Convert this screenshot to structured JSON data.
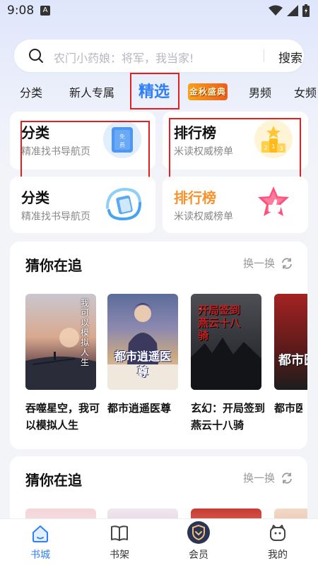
{
  "status_bar": {
    "time": "9:08",
    "notification_badge": "A"
  },
  "search": {
    "placeholder": "农门小药娘：将军，我当家!",
    "button_label": "搜索"
  },
  "tabs": [
    {
      "label": "分类"
    },
    {
      "label": "新人专属"
    },
    {
      "label": "精选",
      "active": true
    },
    {
      "label": "金秋盛典",
      "type": "event-badge"
    },
    {
      "label": "男频"
    },
    {
      "label": "女频"
    }
  ],
  "quick_cards": [
    {
      "title": "分类",
      "subtitle": "精准找书导航页",
      "icon": "book-free-icon",
      "icon_text": "免费"
    },
    {
      "title": "排行榜",
      "subtitle": "米读权威榜单",
      "icon": "podium-icon",
      "icon_text": "2 1 3"
    },
    {
      "title": "分类",
      "subtitle": "精准找书导航页",
      "icon": "swirl-book-icon"
    },
    {
      "title": "排行榜",
      "subtitle": "米读权威榜单",
      "icon": "thumbs-up-star-icon",
      "title_color": "#f7932c"
    }
  ],
  "sections": [
    {
      "title": "猜你在追",
      "refresh_label": "换一换",
      "books": [
        {
          "title": "吞噬星空，我可以模拟人生",
          "cover_text": "我可以模拟人生"
        },
        {
          "title": "都市逍遥医尊",
          "cover_text": "都市逍遥医尊"
        },
        {
          "title": "玄幻：开局签到燕云十八骑",
          "cover_text": "开局签到燕云十八骑"
        },
        {
          "title": "都市医",
          "cover_text": "都市医"
        }
      ]
    },
    {
      "title": "猜你在追",
      "refresh_label": "换一换"
    }
  ],
  "bottom_nav": [
    {
      "label": "书城",
      "icon": "home-icon",
      "active": true
    },
    {
      "label": "书架",
      "icon": "bookshelf-icon"
    },
    {
      "label": "会员",
      "icon": "vip-shield-icon"
    },
    {
      "label": "我的",
      "icon": "profile-icon"
    }
  ],
  "colors": {
    "accent": "#2f7ff5",
    "highlight_box": "#e51f1f",
    "rank_orange": "#f7932c"
  }
}
